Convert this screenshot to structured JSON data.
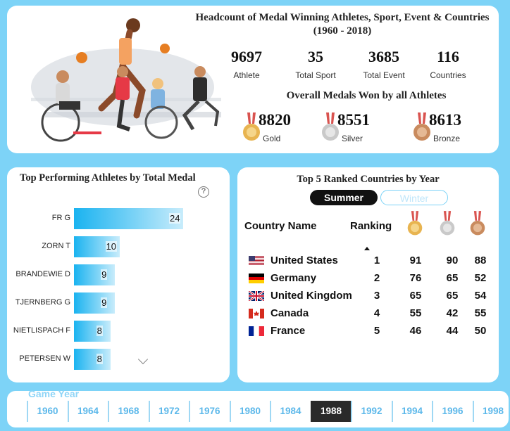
{
  "header": {
    "title": "Headcount of Medal Winning Athletes, Sport, Event & Countries",
    "subtitle": "(1960 - 2018)"
  },
  "kpis": [
    {
      "value": "9697",
      "label": "Athlete"
    },
    {
      "value": "35",
      "label": "Total Sport"
    },
    {
      "value": "3685",
      "label": "Total Event"
    },
    {
      "value": "116",
      "label": "Countries"
    }
  ],
  "medals": {
    "title": "Overall Medals Won by all  Athletes",
    "gold": {
      "value": "8820",
      "label": "Gold"
    },
    "silver": {
      "value": "8551",
      "label": "Silver"
    },
    "bronze": {
      "value": "8613",
      "label": "Bronze"
    }
  },
  "athletes_chart": {
    "title": "Top Performing Athletes by Total Medal",
    "help": "?"
  },
  "chart_data": {
    "type": "bar",
    "orientation": "horizontal",
    "title": "Top Performing Athletes by Total Medal",
    "categories": [
      "FR G",
      "ZORN T",
      "BRANDEWIE D",
      "TJERNBERG G",
      "NIETLISPACH F",
      "PETERSEN W"
    ],
    "values": [
      24,
      10,
      9,
      9,
      8,
      8
    ],
    "xlim": [
      0,
      24
    ]
  },
  "countries": {
    "title": "Top 5 Ranked Countries by Year",
    "toggle_on": "Summer",
    "toggle_off": "Winter",
    "col_country": "Country Name",
    "col_ranking": "Ranking",
    "rows": [
      {
        "name": "United States",
        "flag": "us",
        "rank": "1",
        "gold": "91",
        "silver": "90",
        "bronze": "88"
      },
      {
        "name": "Germany",
        "flag": "de",
        "rank": "2",
        "gold": "76",
        "silver": "65",
        "bronze": "52"
      },
      {
        "name": "United Kingdom",
        "flag": "uk",
        "rank": "3",
        "gold": "65",
        "silver": "65",
        "bronze": "54"
      },
      {
        "name": "Canada",
        "flag": "ca",
        "rank": "4",
        "gold": "55",
        "silver": "42",
        "bronze": "55"
      },
      {
        "name": "France",
        "flag": "fr",
        "rank": "5",
        "gold": "46",
        "silver": "44",
        "bronze": "50"
      }
    ]
  },
  "year_filter": {
    "label": "Game Year",
    "years": [
      "1960",
      "1964",
      "1968",
      "1972",
      "1976",
      "1980",
      "1984",
      "1988",
      "1992",
      "1994",
      "1996",
      "1998"
    ],
    "selected": "1988"
  },
  "colors": {
    "background": "#7dd3f7",
    "bar": "#1ab3f0",
    "gold": "#e8b450",
    "silver": "#c9c9c9",
    "bronze": "#c98b5e",
    "year_text": "#5cb8ea"
  }
}
